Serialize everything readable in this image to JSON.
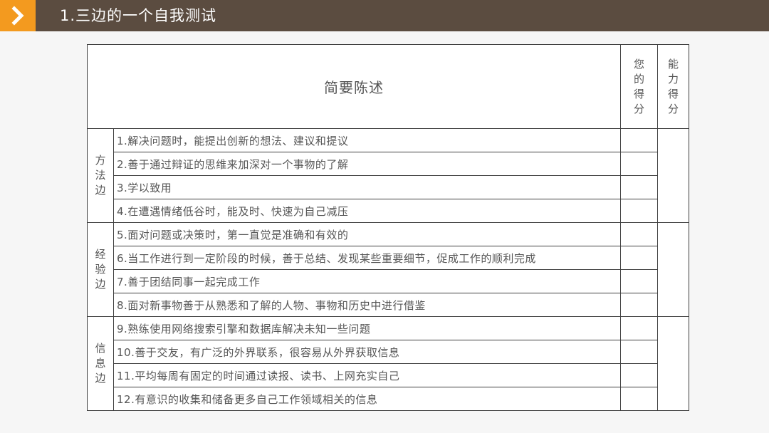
{
  "header": {
    "title": "1.三边的一个自我测试",
    "icon": "chevron-right-icon",
    "accent_color": "#f39a1f",
    "bar_color": "#5b4c40"
  },
  "table": {
    "summary_header": "简要陈述",
    "your_score_header": "您的得分",
    "ability_score_header": "能力得分",
    "groups": [
      {
        "name": "方法边",
        "items": [
          "1.解决问题时，能提出创新的想法、建议和提议",
          "2.善于通过辩证的思维来加深对一个事物的了解",
          "3.学以致用",
          "4.在遭遇情绪低谷时，能及时、快速为自己减压"
        ]
      },
      {
        "name": "经验边",
        "items": [
          "5.面对问题或决策时，第一直觉是准确和有效的",
          "6.当工作进行到一定阶段的时候，善于总结、发现某些重要细节，促成工作的顺利完成",
          "7.善于团结同事一起完成工作",
          "8.面对新事物善于从熟悉和了解的人物、事物和历史中进行借鉴"
        ]
      },
      {
        "name": "信息边",
        "items": [
          "9.熟练使用网络搜索引擎和数据库解决未知一些问题",
          "10.善于交友，有广泛的外界联系，很容易从外界获取信息",
          "11.平均每周有固定的时间通过读报、读书、上网充实自己",
          "12.有意识的收集和储备更多自己工作领域相关的信息"
        ]
      }
    ]
  }
}
